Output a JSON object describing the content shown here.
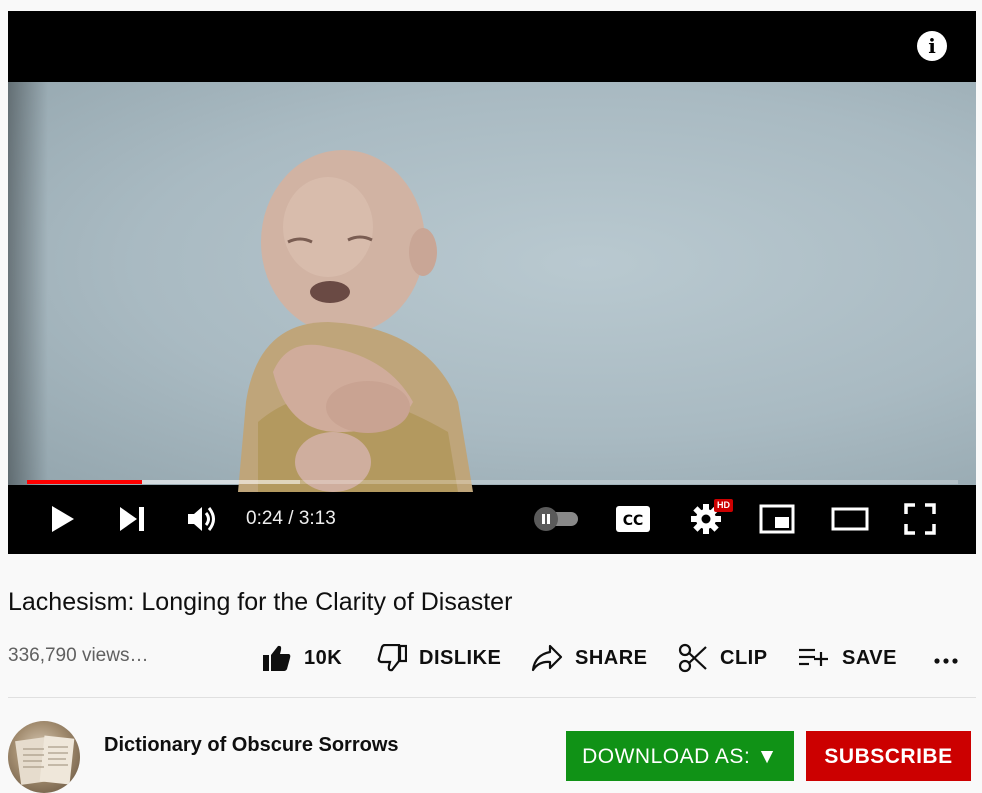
{
  "player": {
    "time_current": "0:24",
    "time_separator": " / ",
    "time_total": "3:13",
    "progress_played_fraction": 0.124,
    "progress_buffered_fraction": 0.293,
    "hd_badge": "HD",
    "info_label": "i",
    "colors": {
      "progress_played": "#ff0000",
      "hd_badge": "#cc0000"
    },
    "icons": [
      "play-icon",
      "next-icon",
      "volume-icon",
      "autoplay-toggle-icon",
      "captions-icon",
      "settings-icon",
      "miniplayer-icon",
      "theater-mode-icon",
      "fullscreen-icon",
      "info-icon"
    ]
  },
  "video": {
    "title": "Lachesism: Longing for the Clarity of Disaster",
    "views": "336,790 views…"
  },
  "actions": {
    "like_count": "10K",
    "dislike_label": "DISLIKE",
    "share_label": "SHARE",
    "clip_label": "CLIP",
    "save_label": "SAVE"
  },
  "channel": {
    "name": "Dictionary of Obscure Sorrows",
    "download_label": "DOWNLOAD AS: ▼",
    "subscribe_label": "SUBSCRIBE",
    "colors": {
      "download": "#109216",
      "subscribe": "#cc0000"
    }
  }
}
